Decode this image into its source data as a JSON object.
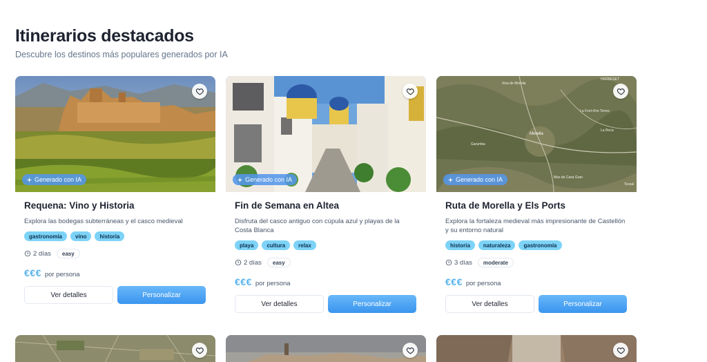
{
  "header": {
    "title": "Itinerarios destacados",
    "subtitle": "Descubre los destinos más populares generados por IA"
  },
  "cards": [
    {
      "title": "Requena: Vino y Historia",
      "description": "Explora las bodegas subterráneas y el casco medieval",
      "badge": "Generado con IA",
      "tags": [
        "gastronomía",
        "vino",
        "historia"
      ],
      "duration": "2 días",
      "difficulty": "easy",
      "price": "€€€",
      "price_label": "por persona",
      "details_label": "Ver detalles",
      "customize_label": "Personalizar"
    },
    {
      "title": "Fin de Semana en Altea",
      "description": "Disfruta del casco antiguo con cúpula azul y playas de la Costa Blanca",
      "badge": "Generado con IA",
      "tags": [
        "playa",
        "cultura",
        "relax"
      ],
      "duration": "2 días",
      "difficulty": "easy",
      "price": "€€€",
      "price_label": "por persona",
      "details_label": "Ver detalles",
      "customize_label": "Personalizar"
    },
    {
      "title": "Ruta de Morella y Els Ports",
      "description": "Explora la fortaleza medieval más impresionante de Castellón y su entorno natural",
      "badge": "Generado con IA",
      "tags": [
        "historia",
        "naturaleza",
        "gastronomía"
      ],
      "duration": "3 días",
      "difficulty": "moderate",
      "price": "€€€",
      "price_label": "por persona",
      "details_label": "Ver detalles",
      "customize_label": "Personalizar"
    }
  ],
  "map_labels": [
    "Xiva de Morella",
    "HERBESET",
    "La Font d'en Torres",
    "La Roca",
    "Garumba",
    "Morella",
    "Mas de Casa Gran",
    "Tossal"
  ],
  "icons": {
    "favorite": "heart-icon",
    "badge": "sparkle-icon",
    "duration": "clock-icon"
  },
  "colors": {
    "tag_bg": "#7dd3f7",
    "price": "#5ab3ec",
    "primary_button": "#3a95ef",
    "badge_bg": "#5496eb"
  }
}
